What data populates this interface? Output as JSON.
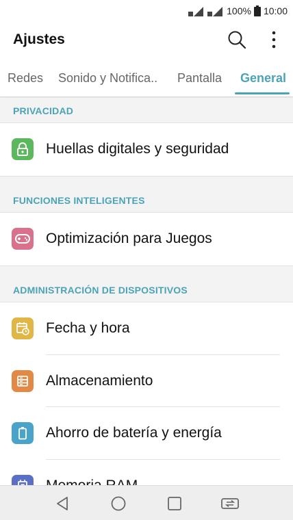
{
  "status_bar": {
    "battery": "100%",
    "time": "10:00"
  },
  "app_bar": {
    "title": "Ajustes"
  },
  "tabs": [
    {
      "label": "Redes",
      "active": false
    },
    {
      "label": "Sonido y Notifica..",
      "active": false
    },
    {
      "label": "Pantalla",
      "active": false
    },
    {
      "label": "General",
      "active": true
    }
  ],
  "sections": [
    {
      "header": "PRIVACIDAD",
      "items": [
        {
          "label": "Huellas digitales y seguridad",
          "icon": "lock-icon",
          "color": "#5cb85c"
        }
      ]
    },
    {
      "header": "FUNCIONES INTELIGENTES",
      "items": [
        {
          "label": "Optimización para Juegos",
          "icon": "gamepad-icon",
          "color": "#d9718c"
        }
      ]
    },
    {
      "header": "ADMINISTRACIÓN DE DISPOSITIVOS",
      "items": [
        {
          "label": "Fecha y hora",
          "icon": "calendar-clock-icon",
          "color": "#e0b646"
        },
        {
          "label": "Almacenamiento",
          "icon": "storage-icon",
          "color": "#e28a45"
        },
        {
          "label": "Ahorro de batería y energía",
          "icon": "battery-icon",
          "color": "#4aa3c8"
        },
        {
          "label": "Memoria RAM",
          "icon": "memory-icon",
          "color": "#5b6fc4"
        }
      ]
    }
  ],
  "colors": {
    "accent": "#4aa3b8"
  }
}
